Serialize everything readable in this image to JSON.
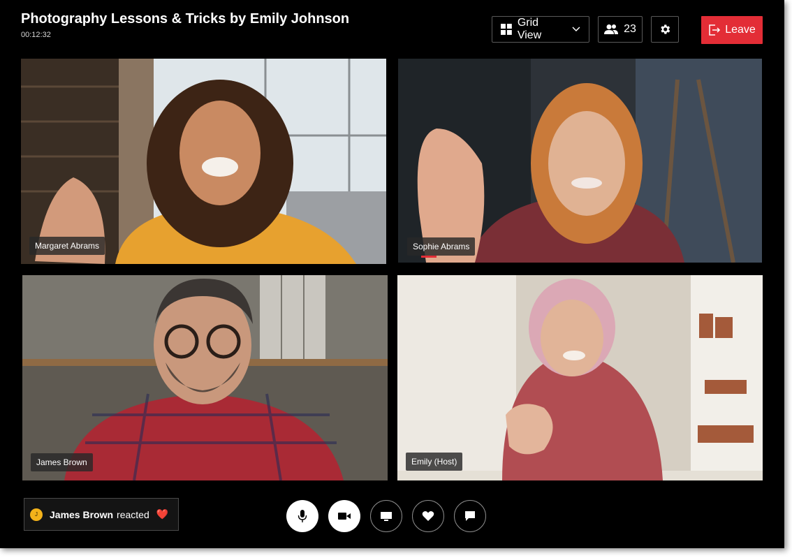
{
  "meeting": {
    "title": "Photography Lessons & Tricks by Emily Johnson",
    "elapsed": "00:12:32"
  },
  "toolbar": {
    "view_label": "Grid View",
    "participant_count": "23",
    "leave_label": "Leave"
  },
  "participants": [
    {
      "name": "Margaret Abrams",
      "speaking": false
    },
    {
      "name": "Sophie Abrams",
      "speaking": true
    },
    {
      "name": "James Brown",
      "speaking": false
    },
    {
      "name": "Emily (Host)",
      "speaking": false
    }
  ],
  "reaction_toast": {
    "avatar_initial": "J",
    "name": "James Brown",
    "text": "reacted",
    "emoji": "❤️"
  },
  "controls": [
    {
      "icon": "microphone-icon",
      "active": true
    },
    {
      "icon": "video-camera-icon",
      "active": true
    },
    {
      "icon": "screen-share-icon",
      "active": false
    },
    {
      "icon": "heart-icon",
      "active": false
    },
    {
      "icon": "chat-icon",
      "active": false
    }
  ],
  "colors": {
    "accent_red": "#e32d36",
    "background": "#000000",
    "avatar_yellow": "#f3b21a"
  }
}
